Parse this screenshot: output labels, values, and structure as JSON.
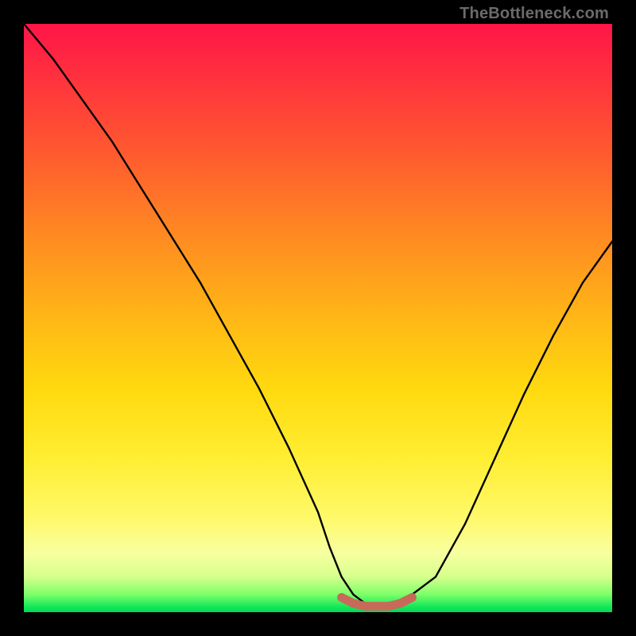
{
  "watermark": "TheBottleneck.com",
  "chart_data": {
    "type": "line",
    "title": "",
    "xlabel": "",
    "ylabel": "",
    "xlim": [
      0,
      100
    ],
    "ylim": [
      0,
      100
    ],
    "grid": false,
    "series": [
      {
        "name": "bottleneck-curve",
        "color": "#000000",
        "x": [
          0,
          5,
          10,
          15,
          20,
          25,
          30,
          35,
          40,
          45,
          50,
          52,
          54,
          56,
          58,
          60,
          62,
          64,
          70,
          75,
          80,
          85,
          90,
          95,
          100
        ],
        "y": [
          100,
          94,
          87,
          80,
          72,
          64,
          56,
          47,
          38,
          28,
          17,
          11,
          6,
          3,
          1.5,
          1,
          1,
          1.5,
          6,
          15,
          26,
          37,
          47,
          56,
          63
        ]
      },
      {
        "name": "highlight-band",
        "color": "#c76a5a",
        "x": [
          54,
          56,
          58,
          60,
          62,
          64,
          66
        ],
        "y": [
          2.5,
          1.5,
          1,
          1,
          1,
          1.5,
          2.5
        ]
      }
    ],
    "gradient_stops": [
      {
        "pos": 0,
        "color": "#ff1547"
      },
      {
        "pos": 8,
        "color": "#ff2e3f"
      },
      {
        "pos": 22,
        "color": "#ff5a2f"
      },
      {
        "pos": 36,
        "color": "#ff8a22"
      },
      {
        "pos": 50,
        "color": "#ffb716"
      },
      {
        "pos": 62,
        "color": "#ffd90f"
      },
      {
        "pos": 74,
        "color": "#ffee33"
      },
      {
        "pos": 84,
        "color": "#fff96a"
      },
      {
        "pos": 90,
        "color": "#f8ffa0"
      },
      {
        "pos": 94,
        "color": "#d6ff8c"
      },
      {
        "pos": 97,
        "color": "#7eff6a"
      },
      {
        "pos": 99,
        "color": "#17e85a"
      },
      {
        "pos": 100,
        "color": "#00d858"
      }
    ]
  }
}
